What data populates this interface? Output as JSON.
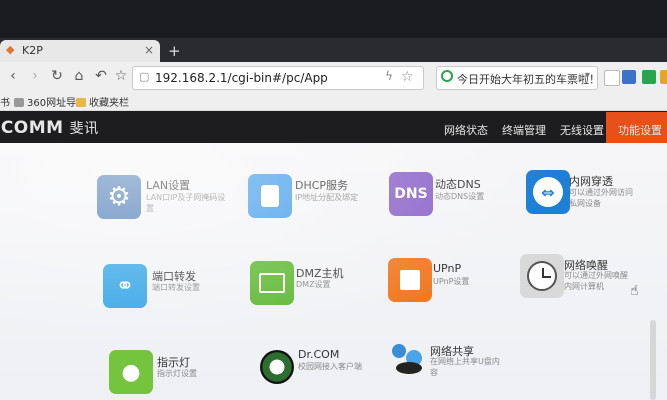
{
  "browser": {
    "tab_title": "K2P",
    "new_tab": "+",
    "url": "192.168.2.1/cgi-bin#/pc/App",
    "search_text": "今日开始大年初五的车票啦！",
    "bookmarks": [
      {
        "label": "书"
      },
      {
        "label": "360网址导"
      },
      {
        "label": "收藏夹栏"
      }
    ]
  },
  "router": {
    "logo": "ICOMM",
    "logo_cn": "斐讯",
    "nav": [
      "网络状态",
      "终端管理",
      "无线设置",
      "功能设置"
    ],
    "active_nav": "功能设置",
    "accent": "#e8501a"
  },
  "apps": [
    {
      "name": "LAN设置",
      "desc": "LAN口IP及子网掩码设置",
      "icon": "gear-icon",
      "color": "#4a7ab5"
    },
    {
      "name": "DHCP服务",
      "desc": "IP地址分配及绑定",
      "icon": "dhcp-icon",
      "color": "#3f9be8"
    },
    {
      "name": "动态DNS",
      "desc": "动态DNS设置",
      "icon": "dns-icon",
      "color": "#8b63c9",
      "glyph": "DNS"
    },
    {
      "name": "内网穿透",
      "desc": "可以通过外网访问私网设备",
      "icon": "teamviewer-icon",
      "color": "#1d7fd6"
    },
    {
      "name": "端口转发",
      "desc": "端口转发设置",
      "icon": "link-icon",
      "color": "#34a5e6"
    },
    {
      "name": "DMZ主机",
      "desc": "DMZ设置",
      "icon": "dmz-icon",
      "color": "#5db832"
    },
    {
      "name": "UPnP",
      "desc": "UPnP设置",
      "icon": "upnp-icon",
      "color": "#f07a23"
    },
    {
      "name": "网络唤醒",
      "desc": "可以通过外网唤醒内网计算机",
      "icon": "clock-icon",
      "color": "#d9d9d9"
    },
    {
      "name": "指示灯",
      "desc": "指示灯设置",
      "icon": "bulb-icon",
      "color": "#74c43e"
    },
    {
      "name": "Dr.COM",
      "desc": "校园网接入客户端",
      "icon": "drcom-icon",
      "color": "#2c6e2f"
    },
    {
      "name": "网络共享",
      "desc": "在网络上共享U盘内容",
      "icon": "share-icon",
      "color": "#3a8ed6"
    }
  ]
}
